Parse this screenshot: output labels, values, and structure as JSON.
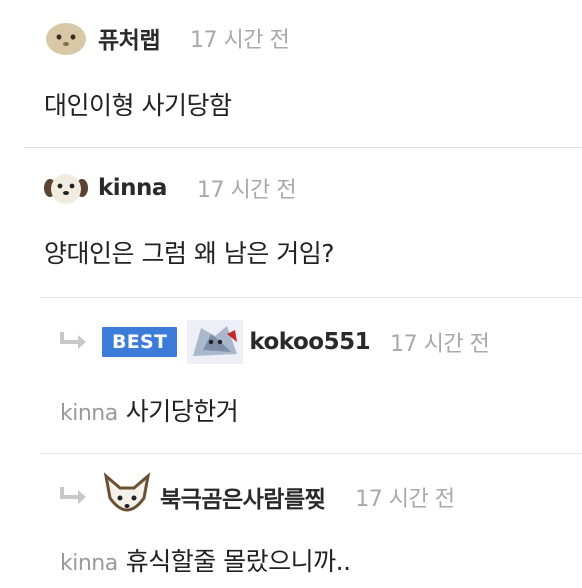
{
  "comments": [
    {
      "username": "퓨처랩",
      "time": "17 시간 전",
      "text": "대인이형 사기당함"
    },
    {
      "username": "kinna",
      "time": "17 시간 전",
      "text": "양대인은 그럼 왜 남은 거임?"
    },
    {
      "badge": "BEST",
      "username": "kokoo551",
      "time": "17 시간 전",
      "mention": "kinna",
      "text": "사기당한거"
    },
    {
      "username": "북극곰은사람를찢",
      "time": "17 시간 전",
      "mention": "kinna",
      "text": "휴식할줄 몰랐으니까.."
    }
  ],
  "colors": {
    "best_badge": "#3c7bd8",
    "time": "#a9a9a9",
    "mention": "#9a9a9a",
    "divider": "#e3e3e3"
  },
  "icons": [
    "avatar-blob-icon",
    "avatar-dog-icon",
    "avatar-creature-icon",
    "avatar-cat-icon",
    "reply-arrow-icon"
  ]
}
